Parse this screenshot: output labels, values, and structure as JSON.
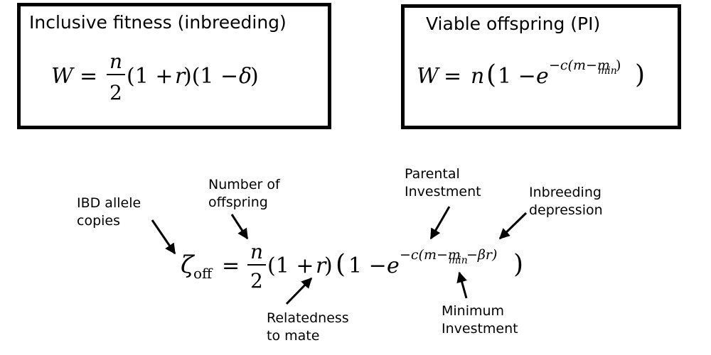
{
  "box1": {
    "title": "Inclusive fitness (inbreeding)",
    "equation": "W = n/2 (1 + r)(1 − δ)"
  },
  "box2": {
    "title": "Viable offspring (PI)",
    "equation": "W = n (1 − e^(−c(m − m_min)))"
  },
  "main_equation": "ζ_off = n/2 (1 + r) (1 − e^(−c(m − m_min − βr)))",
  "labels": {
    "ibd": "IBD allele\ncopies",
    "offspring": "Number of\noffspring",
    "parental": "Parental\nInvestment",
    "inbreeding": "Inbreeding\ndepression",
    "relatedness": "Relatedness\nto mate",
    "minimum": "Minimum\nInvestment"
  },
  "colors": {
    "ink": "#000000",
    "background": "#ffffff"
  }
}
